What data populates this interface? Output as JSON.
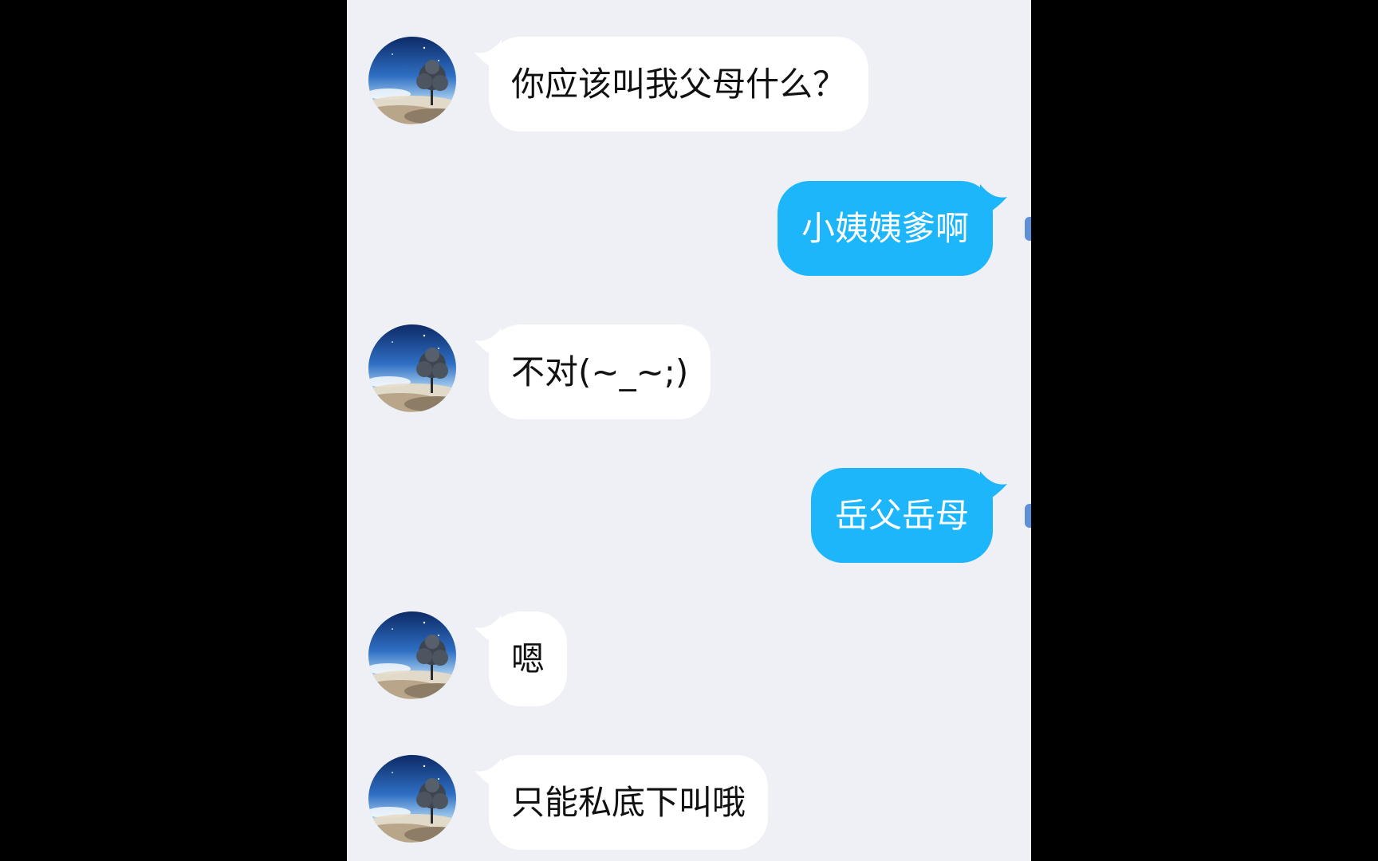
{
  "colors": {
    "outside": "#000000",
    "chat_background": "#eef0f6",
    "incoming_bubble": "#ffffff",
    "outgoing_bubble": "#1eb6fb",
    "incoming_text": "#111111",
    "outgoing_text": "#ffffff"
  },
  "messages": [
    {
      "direction": "incoming",
      "avatar": "tree-landscape-avatar",
      "text": "你应该叫我父母什么？"
    },
    {
      "direction": "outgoing",
      "text": "小姨姨爹啊"
    },
    {
      "direction": "incoming",
      "avatar": "tree-landscape-avatar",
      "text": "不对(~_~;)"
    },
    {
      "direction": "outgoing",
      "text": "岳父岳母"
    },
    {
      "direction": "incoming",
      "avatar": "tree-landscape-avatar",
      "text": "嗯"
    },
    {
      "direction": "incoming",
      "avatar": "tree-landscape-avatar",
      "text": "只能私底下叫哦"
    }
  ]
}
